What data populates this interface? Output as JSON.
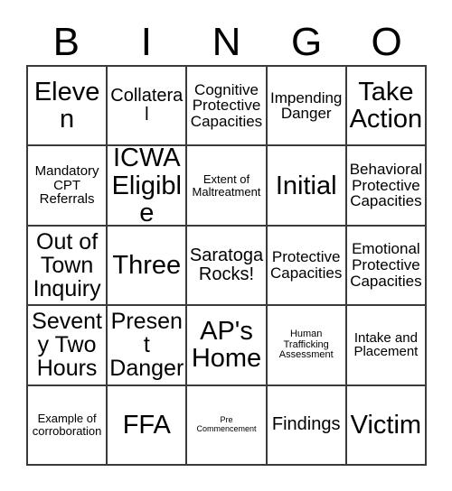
{
  "card": {
    "title": "Bingo Card",
    "header_letters": [
      "B",
      "I",
      "N",
      "G",
      "O"
    ],
    "grid_size": "5x5",
    "line_color": "#3a3a3a",
    "background_color": "#ffffff",
    "text_color": "#000000",
    "rows": [
      [
        {
          "text": "Eleven",
          "size": "sz-xxl"
        },
        {
          "text": "Collateral",
          "size": "sz-l"
        },
        {
          "text": "Cognitive Protective Capacities",
          "size": "sz-m"
        },
        {
          "text": "Impending Danger",
          "size": "sz-m"
        },
        {
          "text": "Take Action",
          "size": "sz-xxl"
        }
      ],
      [
        {
          "text": "Mandatory CPT Referrals",
          "size": "sz-s"
        },
        {
          "text": "ICWA Eligible",
          "size": "sz-xxl"
        },
        {
          "text": "Extent of Maltreatment",
          "size": "sz-xs"
        },
        {
          "text": "Initial",
          "size": "sz-xxl"
        },
        {
          "text": "Behavioral Protective Capacities",
          "size": "sz-m"
        }
      ],
      [
        {
          "text": "Out of Town Inquiry",
          "size": "sz-xl"
        },
        {
          "text": "Three",
          "size": "sz-xxl"
        },
        {
          "text": "Saratoga Rocks!",
          "size": "sz-l"
        },
        {
          "text": "Protective Capacities",
          "size": "sz-m"
        },
        {
          "text": "Emotional Protective Capacities",
          "size": "sz-m"
        }
      ],
      [
        {
          "text": "Seventy Two Hours",
          "size": "sz-xl"
        },
        {
          "text": "Present Danger",
          "size": "sz-xl"
        },
        {
          "text": "AP's Home",
          "size": "sz-xxl"
        },
        {
          "text": "Human Trafficking Assessment",
          "size": "sz-xxs"
        },
        {
          "text": "Intake and Placement",
          "size": "sz-s"
        }
      ],
      [
        {
          "text": "Example of corroboration",
          "size": "sz-xs"
        },
        {
          "text": "FFA",
          "size": "sz-xxl"
        },
        {
          "text": "Pre Commencement",
          "size": "sz-tiny"
        },
        {
          "text": "Findings",
          "size": "sz-l"
        },
        {
          "text": "Victim",
          "size": "sz-xxl"
        }
      ]
    ]
  }
}
